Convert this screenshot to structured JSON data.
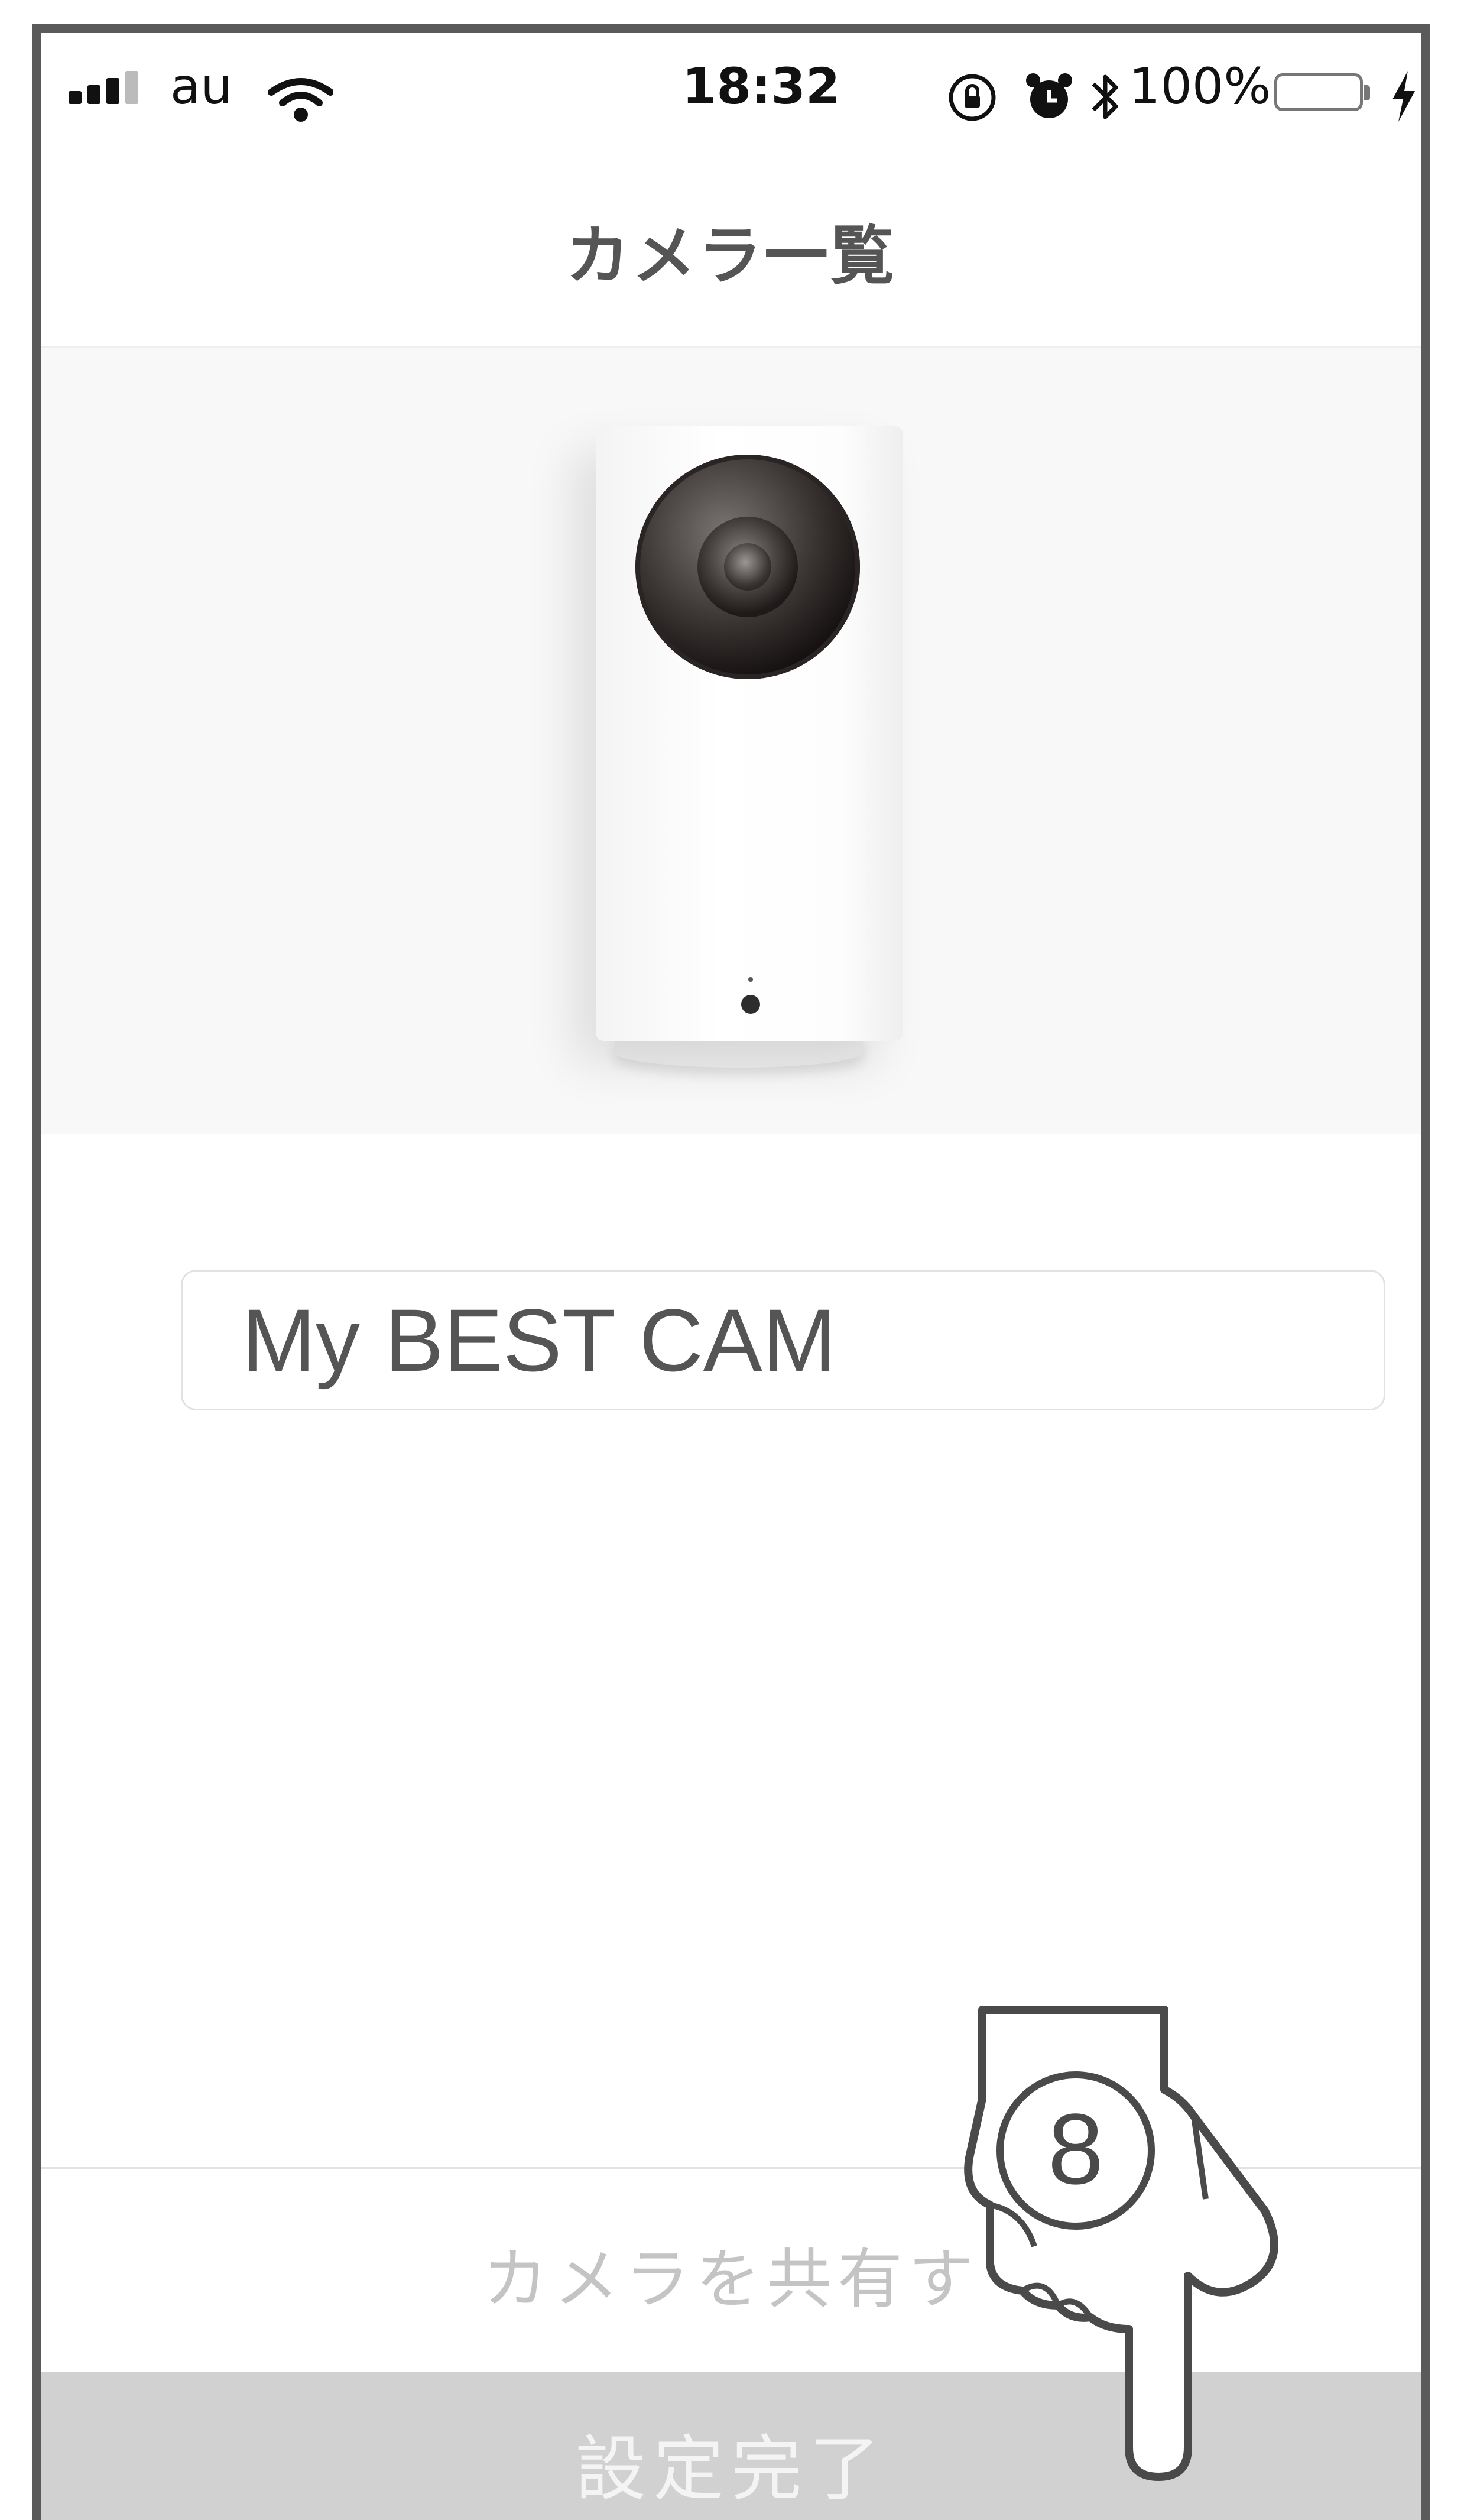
{
  "status_bar": {
    "carrier": "au",
    "time": "18:32",
    "battery_percent": "100%",
    "icons": [
      "signal-icon",
      "wifi-icon",
      "orientation-lock-icon",
      "alarm-icon",
      "bluetooth-icon",
      "battery-icon",
      "charging-icon"
    ]
  },
  "nav": {
    "title": "カメラ一覧"
  },
  "camera": {
    "image": "camera-product-image"
  },
  "name_input": {
    "value": "My BEST CAM"
  },
  "share": {
    "label": "カメラを共有す"
  },
  "footer": {
    "complete_label": "設定完了"
  },
  "annotation": {
    "step_number": "8"
  },
  "colors": {
    "button_bg": "#d1d1d1",
    "share_text": "#c4c4c4",
    "frame": "#5a5a5a"
  }
}
